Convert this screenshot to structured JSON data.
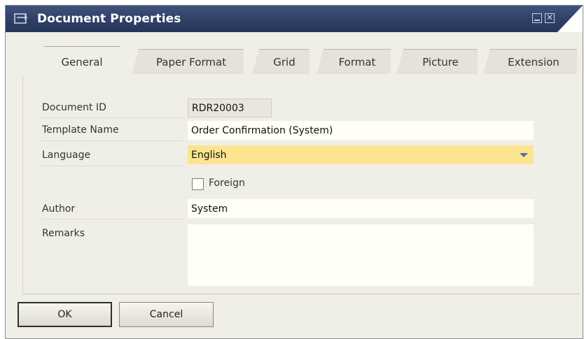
{
  "window": {
    "title": "Document Properties",
    "minimize_icon": "minimize-icon",
    "close_icon": "close-icon"
  },
  "tabs": [
    {
      "label": "General",
      "active": true
    },
    {
      "label": "Paper Format",
      "active": false
    },
    {
      "label": "Grid",
      "active": false
    },
    {
      "label": "Format",
      "active": false
    },
    {
      "label": "Picture",
      "active": false
    },
    {
      "label": "Extension",
      "active": false
    }
  ],
  "form": {
    "document_id": {
      "label": "Document ID",
      "value": "RDR20003"
    },
    "template_name": {
      "label": "Template Name",
      "value": "Order Confirmation (System)"
    },
    "language": {
      "label": "Language",
      "value": "English"
    },
    "foreign": {
      "label": "Foreign",
      "checked": false
    },
    "author": {
      "label": "Author",
      "value": "System"
    },
    "remarks": {
      "label": "Remarks",
      "value": ""
    }
  },
  "buttons": {
    "ok": "OK",
    "cancel": "Cancel"
  },
  "colors": {
    "title_bar": "#2f3f66",
    "selected_field": "#fbe58e",
    "field_bg": "#fffff5",
    "window_bg": "#f0efe7"
  }
}
